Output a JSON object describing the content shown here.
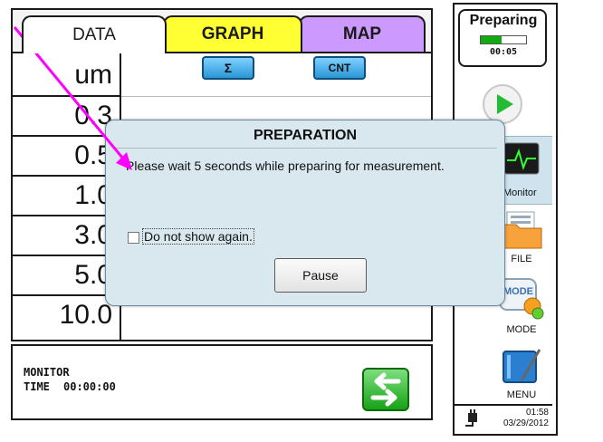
{
  "tabs": [
    {
      "label": "DATA"
    },
    {
      "label": "GRAPH"
    },
    {
      "label": "MAP"
    }
  ],
  "header": {
    "unit_label": "um",
    "sum_button": "Σ",
    "count_button": "CNT"
  },
  "rows": [
    "0.3",
    "0.5",
    "1.0",
    "3.0",
    "5.0",
    "10.0"
  ],
  "monitor": {
    "mode_label": "MONITOR",
    "time_label": "TIME",
    "time_value": "00:00:00",
    "icon": "arrows-exchange-icon"
  },
  "status": {
    "title": "Preparing",
    "timer": "00:05",
    "progress_fraction": 0.45,
    "progress_color": "#11aa11"
  },
  "sidebar": {
    "play_icon": "play-icon",
    "monitor_label": "Monitor",
    "file_label": "FILE",
    "mode_label": "MODE",
    "mode_icon_text": "MODE",
    "menu_label": "MENU",
    "time": "01:58",
    "date": "03/29/2012",
    "power_icon": "power-plug-icon"
  },
  "dialog": {
    "title": "PREPARATION",
    "message": "Please wait 5 seconds while preparing for measurement.",
    "checkbox_label": "Do not show again.",
    "checkbox_checked": false,
    "pause_button": "Pause"
  },
  "colors": {
    "graph_tab": "#ffff33",
    "map_tab": "#cc99ff",
    "dialog_bg": "#d9e8ee",
    "accent_blue": "#2a96d6",
    "arrow_annotation": "#ff00ff"
  }
}
